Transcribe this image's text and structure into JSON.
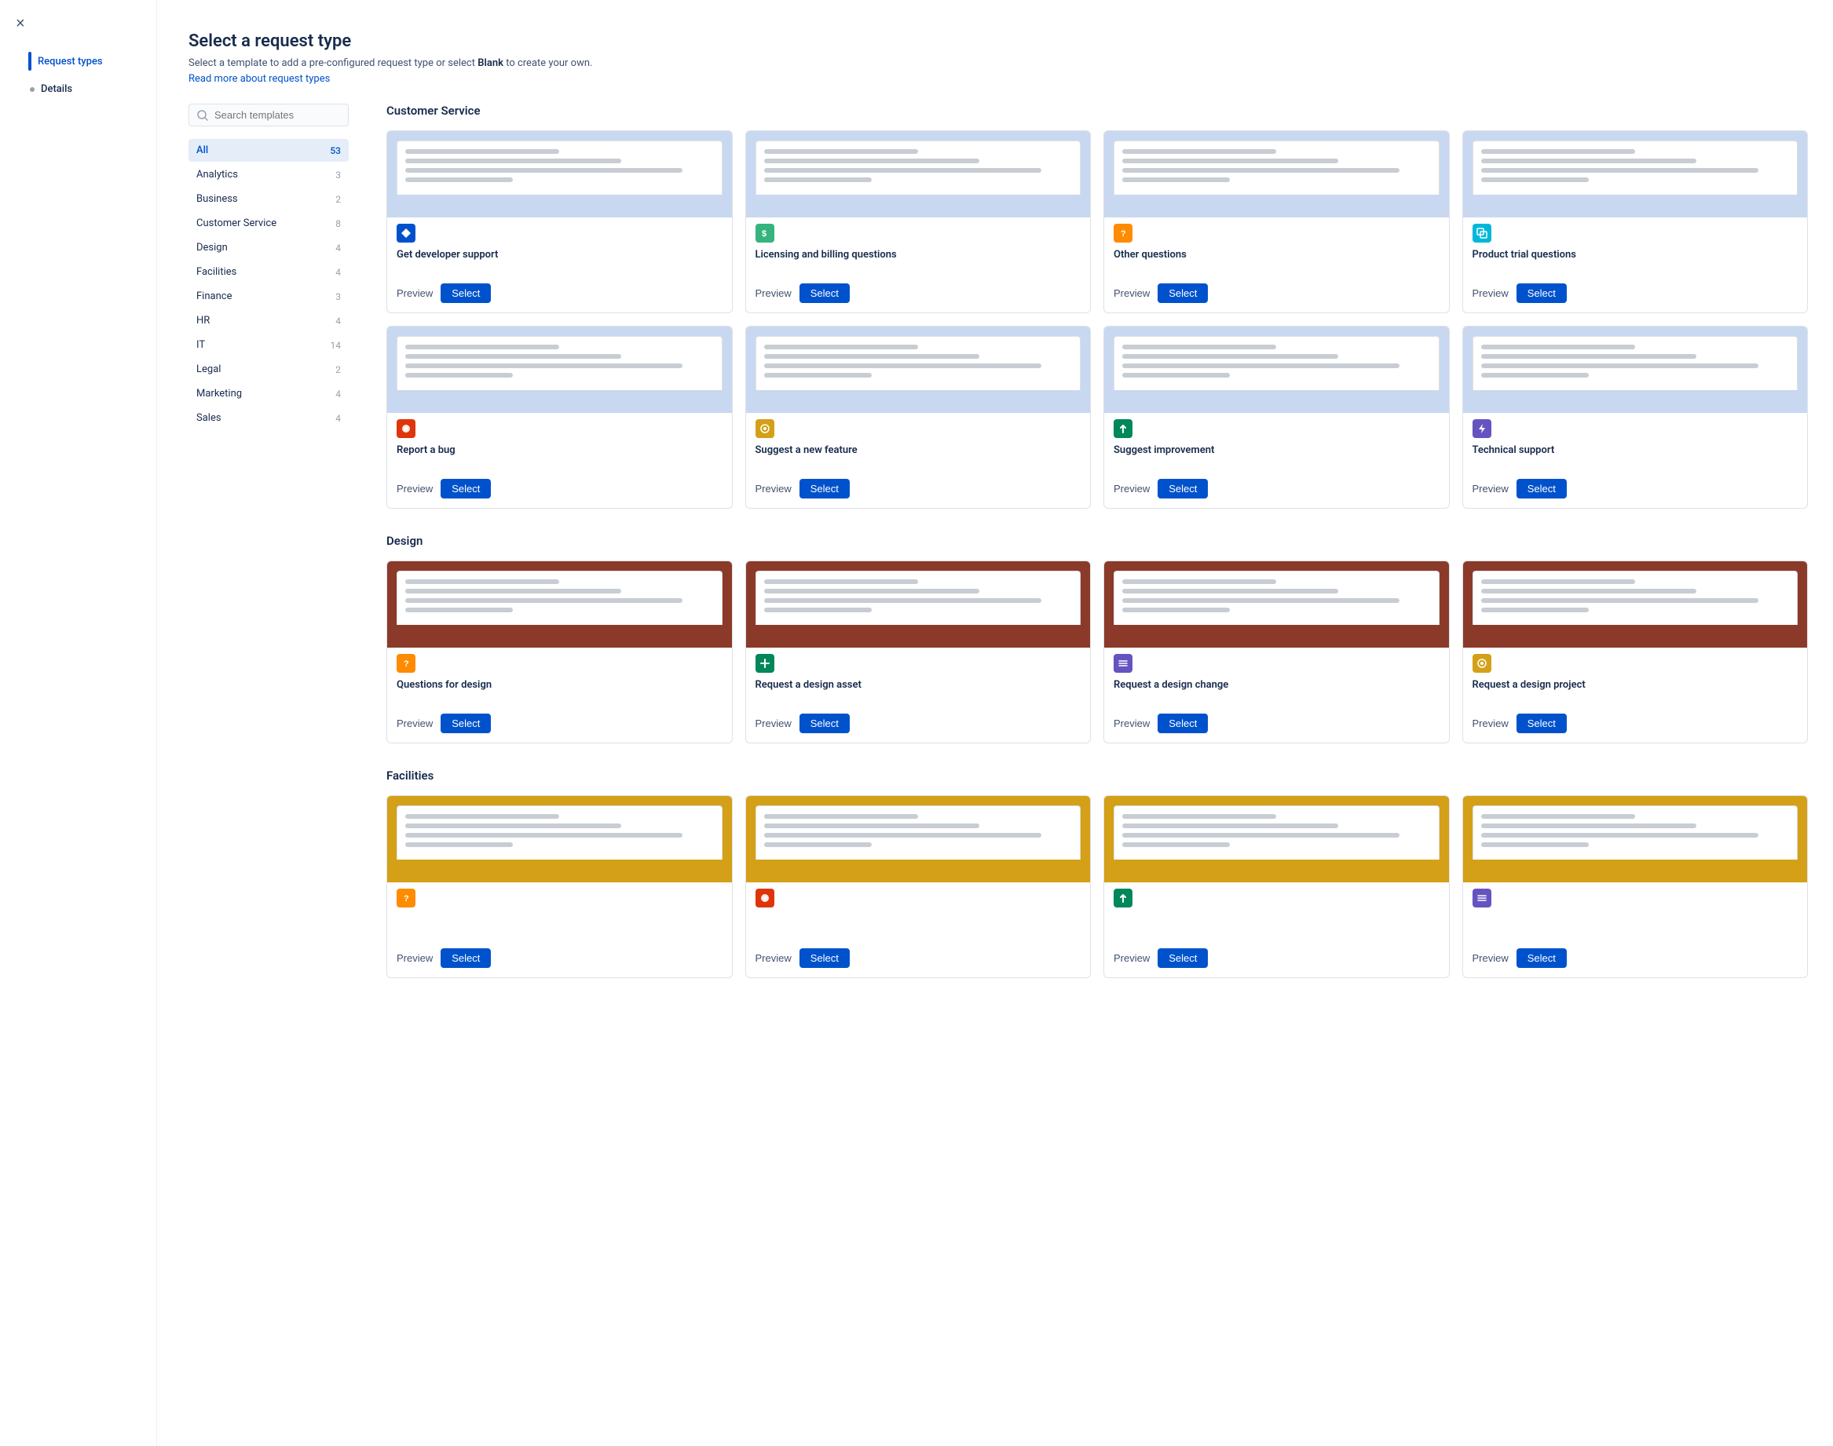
{
  "modal": {
    "title": "Select a request type",
    "subtitle_text": "Select a template to add a pre-configured request type or select ",
    "subtitle_bold": "Blank",
    "subtitle_end": " to create your own.",
    "link_text": "Read more about request types",
    "close_label": "×"
  },
  "sidebar": {
    "nav_items": [
      {
        "id": "request-types",
        "label": "Request types",
        "active": true
      },
      {
        "id": "details",
        "label": "Details",
        "active": false
      }
    ]
  },
  "search": {
    "placeholder": "Search templates"
  },
  "filters": [
    {
      "label": "All",
      "count": 53,
      "active": true
    },
    {
      "label": "Analytics",
      "count": 3,
      "active": false
    },
    {
      "label": "Business",
      "count": 2,
      "active": false
    },
    {
      "label": "Customer Service",
      "count": 8,
      "active": false
    },
    {
      "label": "Design",
      "count": 4,
      "active": false
    },
    {
      "label": "Facilities",
      "count": 4,
      "active": false
    },
    {
      "label": "Finance",
      "count": 3,
      "active": false
    },
    {
      "label": "HR",
      "count": 4,
      "active": false
    },
    {
      "label": "IT",
      "count": 14,
      "active": false
    },
    {
      "label": "Legal",
      "count": 2,
      "active": false
    },
    {
      "label": "Marketing",
      "count": 4,
      "active": false
    },
    {
      "label": "Sales",
      "count": 4,
      "active": false
    }
  ],
  "sections": [
    {
      "title": "Customer Service",
      "cards": [
        {
          "title": "Get developer support",
          "icon": "◇",
          "icon_color": "icon-blue",
          "preview_label": "Preview",
          "select_label": "Select"
        },
        {
          "title": "Licensing and billing questions",
          "icon": "$",
          "icon_color": "icon-green",
          "preview_label": "Preview",
          "select_label": "Select"
        },
        {
          "title": "Other questions",
          "icon": "?",
          "icon_color": "icon-orange",
          "preview_label": "Preview",
          "select_label": "Select"
        },
        {
          "title": "Product trial questions",
          "icon": "⧉",
          "icon_color": "icon-teal",
          "preview_label": "Preview",
          "select_label": "Select"
        },
        {
          "title": "Report a bug",
          "icon": "⬤",
          "icon_color": "icon-red",
          "preview_label": "Preview",
          "select_label": "Select"
        },
        {
          "title": "Suggest a new feature",
          "icon": "◎",
          "icon_color": "icon-yellow",
          "preview_label": "Preview",
          "select_label": "Select"
        },
        {
          "title": "Suggest improvement",
          "icon": "↑",
          "icon_color": "icon-dark-green",
          "preview_label": "Preview",
          "select_label": "Select"
        },
        {
          "title": "Technical support",
          "icon": "⚡",
          "icon_color": "icon-purple",
          "preview_label": "Preview",
          "select_label": "Select"
        }
      ],
      "header_color": "#c8d8f0"
    },
    {
      "title": "Design",
      "cards": [
        {
          "title": "Questions for design",
          "icon": "?",
          "icon_color": "icon-orange",
          "preview_label": "Preview",
          "select_label": "Select"
        },
        {
          "title": "Request a design asset",
          "icon": "+",
          "icon_color": "icon-dark-green",
          "preview_label": "Preview",
          "select_label": "Select"
        },
        {
          "title": "Request a design change",
          "icon": "≡",
          "icon_color": "icon-purple",
          "preview_label": "Preview",
          "select_label": "Select"
        },
        {
          "title": "Request a design project",
          "icon": "◎",
          "icon_color": "icon-yellow",
          "preview_label": "Preview",
          "select_label": "Select"
        }
      ],
      "header_color": "#8b3a2a"
    },
    {
      "title": "Facilities",
      "cards": [
        {
          "title": "",
          "icon": "?",
          "icon_color": "icon-orange",
          "preview_label": "Preview",
          "select_label": "Select"
        },
        {
          "title": "",
          "icon": "⬤",
          "icon_color": "icon-red",
          "preview_label": "Preview",
          "select_label": "Select"
        },
        {
          "title": "",
          "icon": "↑",
          "icon_color": "icon-dark-green",
          "preview_label": "Preview",
          "select_label": "Select"
        },
        {
          "title": "",
          "icon": "≡",
          "icon_color": "icon-purple",
          "preview_label": "Preview",
          "select_label": "Select"
        }
      ],
      "header_color": "#d4a017"
    }
  ]
}
